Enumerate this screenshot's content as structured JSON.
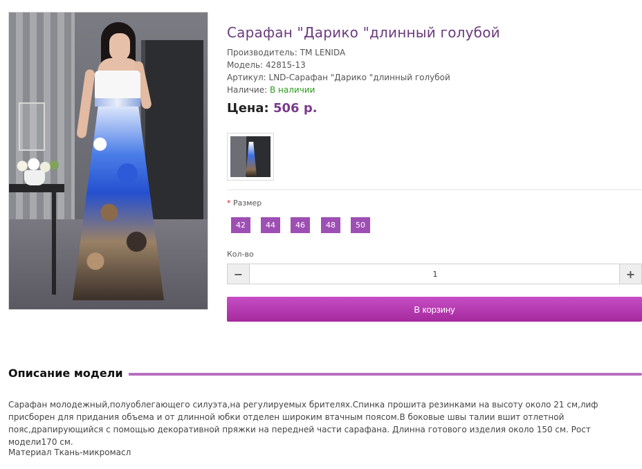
{
  "product": {
    "title": "Сарафан \"Дарико \"длинный голубой",
    "manufacturer_label": "Производитель:",
    "manufacturer": "TM LENIDA",
    "model_label": "Модель:",
    "model": "42815-13",
    "sku_label": "Артикул:",
    "sku": "LND-Сарафан \"Дарико \"длинный голубой",
    "availability_label": "Наличие:",
    "availability": "В наличии",
    "price_label": "Цена:",
    "price": "506 р."
  },
  "options": {
    "size_required_mark": "*",
    "size_label": "Размер",
    "sizes": [
      "42",
      "44",
      "46",
      "48",
      "50"
    ],
    "qty_label": "Кол-во",
    "qty_value": "1",
    "minus_icon": "−",
    "plus_icon": "+",
    "cart_button": "В корзину"
  },
  "description": {
    "heading": "Описание модели",
    "text": "Сарафан молодежный,полуоблегающего силуэта,на регулируемых брителях.Спинка прошита резинками на высоту около 21 см,лиф присборен для придания объема и от длинной юбки отделен широким втачным поясом.В боковые швы талии вшит отлетной пояс,драпирующийся с помощью декоративной пряжки на передней части сарафана. Длинна готового изделия около 150 см. Рост модели170 см.",
    "material": "Материал Ткань-микромасл"
  },
  "colors": {
    "title": "#6b3a7d",
    "accent": "#9e4fb3",
    "cart": "#b33aad",
    "in_stock": "#2a9a1c"
  }
}
